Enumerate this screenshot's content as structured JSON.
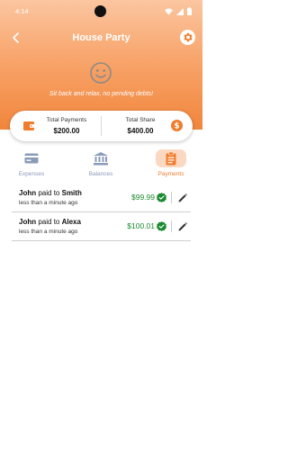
{
  "status_bar": {
    "time": "4:14"
  },
  "header": {
    "title": "House Party",
    "subtitle": "Sit back and relax, no pending debts!"
  },
  "summary": {
    "total_payments_label": "Total Payments",
    "total_payments_value": "$200.00",
    "total_share_label": "Total Share",
    "total_share_value": "$400.00"
  },
  "tabs": [
    {
      "label": "Expenses",
      "icon": "credit-card-icon"
    },
    {
      "label": "Balances",
      "icon": "bank-icon"
    },
    {
      "label": "Payments",
      "icon": "clipboard-icon",
      "active": true
    }
  ],
  "payments": [
    {
      "from": "John",
      "verb": "paid to",
      "to": "Smith",
      "time": "less than a minute ago",
      "amount": "$99.99"
    },
    {
      "from": "John",
      "verb": "paid to",
      "to": "Alexa",
      "time": "less than a minute ago",
      "amount": "$100.01"
    }
  ],
  "colors": {
    "accent": "#f07c2c",
    "amount_green": "#1b8a2e",
    "inactive_tab": "#8a9bb8"
  }
}
